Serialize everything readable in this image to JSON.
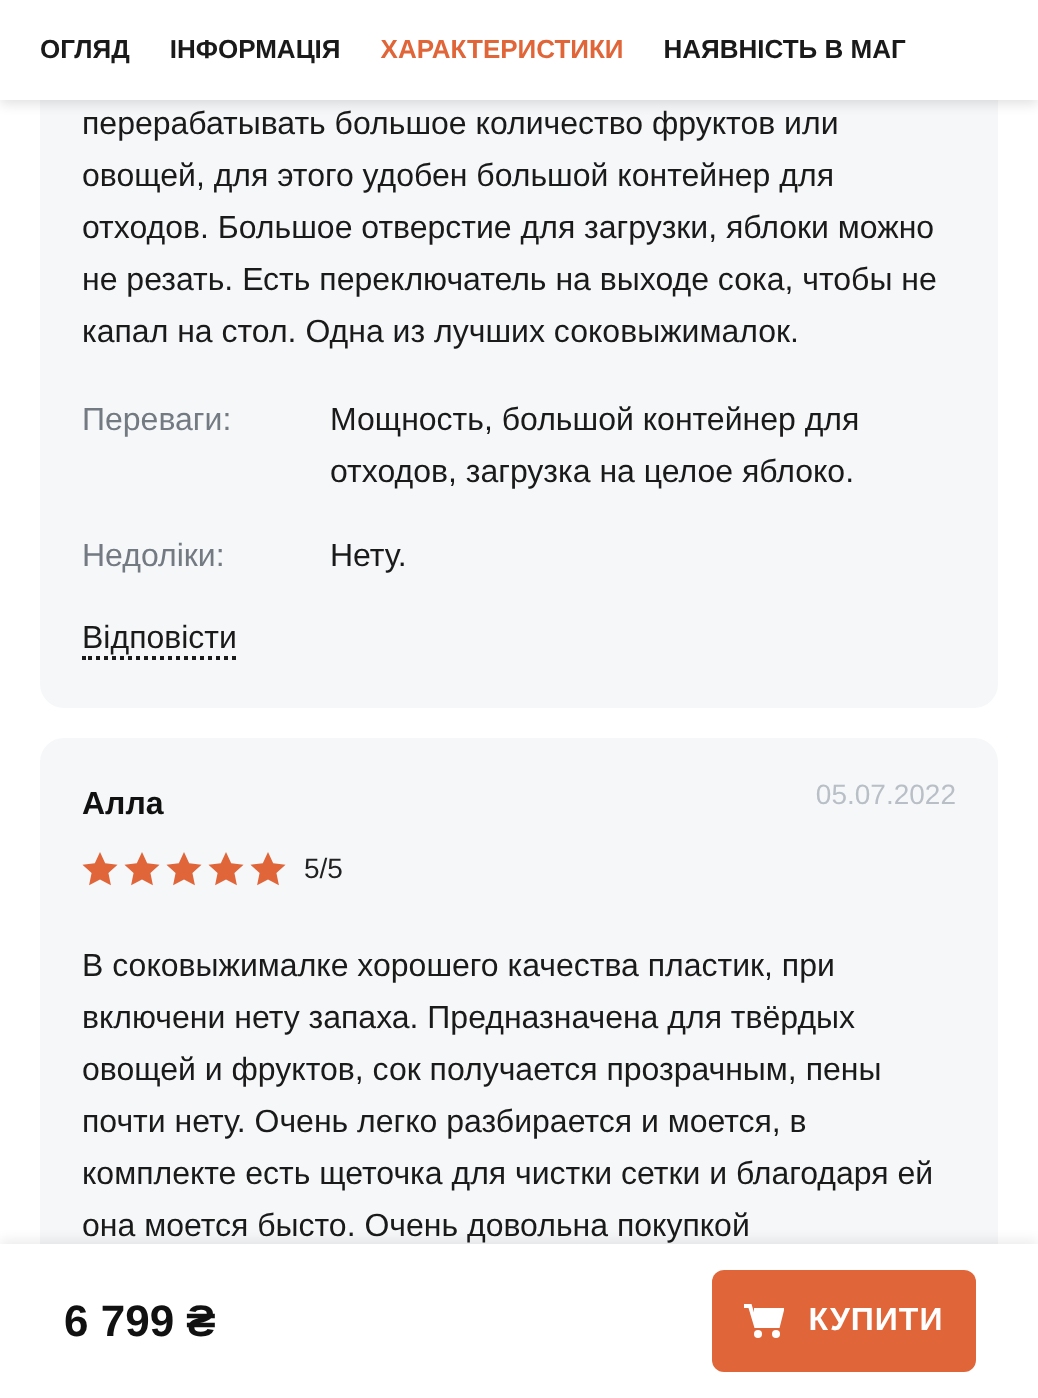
{
  "tabs": [
    {
      "label": "ОГЛЯД",
      "selected": false
    },
    {
      "label": "ІНФОРМАЦІЯ",
      "selected": false
    },
    {
      "label": "ХАРАКТЕРИСТИКИ",
      "selected": true
    },
    {
      "label": "НАЯВНІСТЬ В МАГ",
      "selected": false
    }
  ],
  "reviews": [
    {
      "text": "перерабатывать большое количество фруктов или овощей, для этого удобен большой контейнер для отходов. Большое отверстие для загрузки, яблоки можно не резать. Есть переключатель на выходе сока, чтобы не капал на стол. Одна из лучших соковыжималок.",
      "details": [
        {
          "label": "Переваги:",
          "value": "Мощность, большой контейнер для отходов, загрузка на целое яблоко."
        },
        {
          "label": "Недоліки:",
          "value": "Нету."
        }
      ],
      "reply": "Відповісти"
    },
    {
      "author": "Алла",
      "date": "05.07.2022",
      "stars": 5,
      "rating": "5/5",
      "text": "В соковыжималке хорошего качества пластик, при включени нету запаха. Предназначена для твёрдых овощей и фруктов, сок получается прозрачным, пены почти нету. Очень легко разбирается и моется, в комплекте есть щеточка для чистки сетки и благодаря ей она моется бысто. Очень довольна покупкой"
    }
  ],
  "bottom_bar": {
    "price": "6 799 ₴",
    "buy_button": "КУПИТИ"
  }
}
